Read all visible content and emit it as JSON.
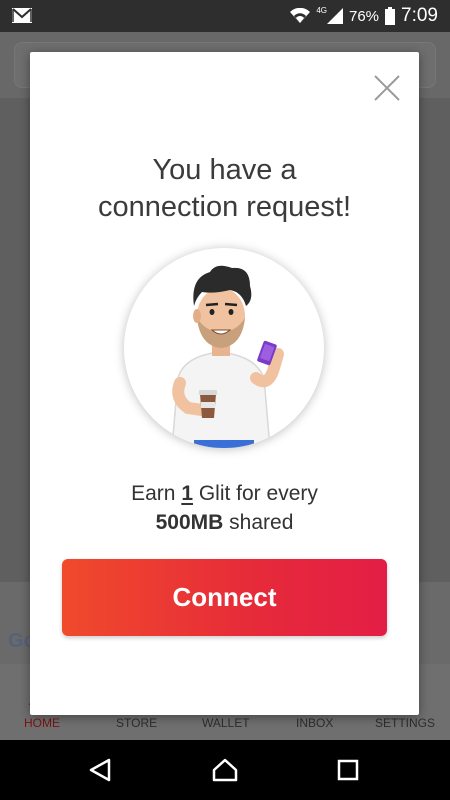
{
  "status_bar": {
    "battery": "76%",
    "network": "4G",
    "time": "7:09",
    "icons": [
      "gmail-icon",
      "wifi-icon",
      "signal-icon",
      "battery-icon"
    ]
  },
  "background_app": {
    "google_label": "Go",
    "nav": {
      "home": "HOME",
      "store": "STORE",
      "wallet": "WALLET",
      "inbox": "INBOX",
      "settings": "SETTINGS"
    }
  },
  "modal": {
    "title_line1": "You have a",
    "title_line2": "connection request!",
    "earn_prefix": "Earn ",
    "earn_amount": "1",
    "earn_suffix": " Glit for every",
    "earn_bold": "500MB",
    "earn_tail": " shared",
    "connect_label": "Connect"
  },
  "colors": {
    "accent_start": "#f04a2c",
    "accent_end": "#e31e46",
    "home_active": "#7a1414"
  }
}
